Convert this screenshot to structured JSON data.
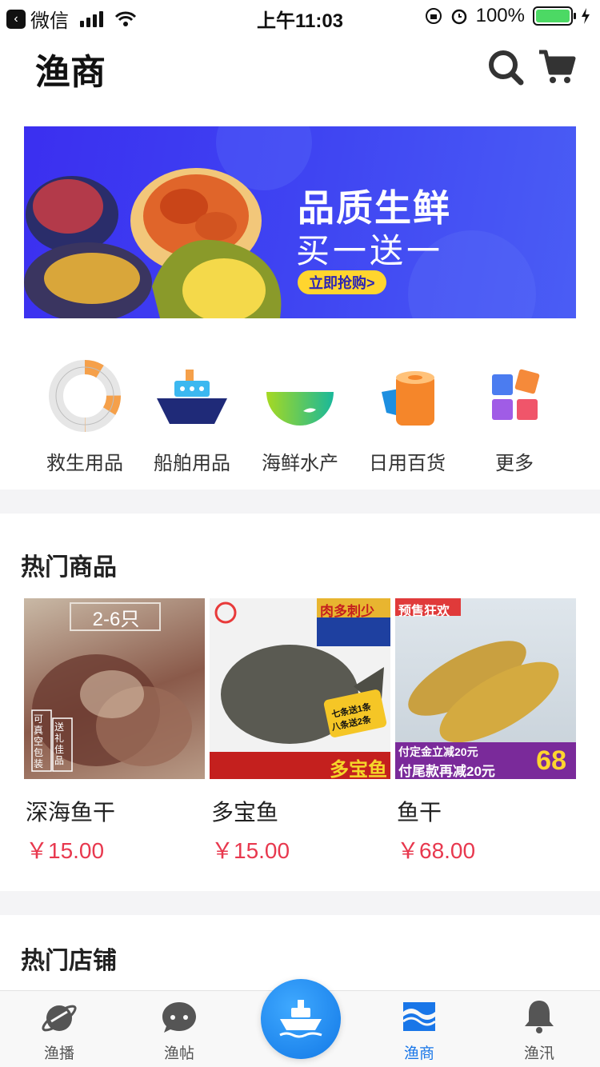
{
  "status_bar": {
    "carrier": "微信",
    "time": "上午11:03",
    "battery": "100%"
  },
  "header": {
    "title": "渔商",
    "icons": [
      "search-icon",
      "cart-icon"
    ]
  },
  "banner": {
    "title": "品质生鲜",
    "subtitle": "买一送一",
    "cta": "立即抢购>"
  },
  "categories": [
    {
      "label": "救生用品",
      "icon": "life-buoy-icon"
    },
    {
      "label": "船舶用品",
      "icon": "ship-icon"
    },
    {
      "label": "海鲜水产",
      "icon": "seafood-bowl-icon"
    },
    {
      "label": "日用百货",
      "icon": "daily-goods-icon"
    },
    {
      "label": "更多",
      "icon": "more-grid-icon"
    }
  ],
  "hot_products": {
    "title": "热门商品",
    "items": [
      {
        "name": "深海鱼干",
        "price": "￥15.00",
        "tags": [
          "2-6只",
          "可真空包装",
          "送礼佳品"
        ]
      },
      {
        "name": "多宝鱼",
        "price": "￥15.00",
        "tags": [
          "肉多刺少",
          "七条送1条",
          "八条送2条",
          "多宝鱼"
        ]
      },
      {
        "name": "鱼干",
        "price": "￥68.00",
        "tags": [
          "预售狂欢",
          "付定金立减20元",
          "付尾款再减20元",
          "68"
        ]
      }
    ]
  },
  "hot_shops": {
    "title": "热门店铺"
  },
  "tabbar": {
    "items": [
      {
        "label": "渔播",
        "icon": "planet-icon",
        "active": false
      },
      {
        "label": "渔帖",
        "icon": "chat-bubble-icon",
        "active": false
      },
      {
        "label": "渔商",
        "icon": "shop-icon",
        "active": true
      },
      {
        "label": "渔汛",
        "icon": "bell-icon",
        "active": false
      }
    ],
    "center_icon": "ship-icon"
  },
  "colors": {
    "accent": "#1976e8",
    "price": "#e8384e",
    "banner_bg": "#3f44f2"
  }
}
